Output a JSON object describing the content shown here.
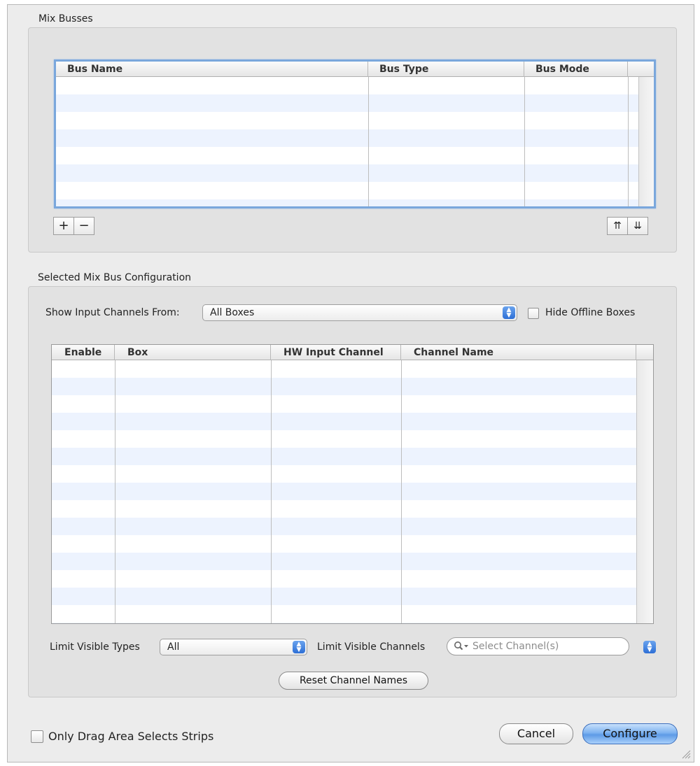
{
  "mix_busses": {
    "title": "Mix Busses",
    "columns": [
      "Bus Name",
      "Bus Type",
      "Bus Mode"
    ],
    "add_label": "+",
    "remove_label": "−",
    "move_up_label": "⇈",
    "move_down_label": "⇊"
  },
  "config": {
    "title": "Selected Mix Bus Configuration",
    "show_from_label": "Show Input Channels From:",
    "show_from_value": "All Boxes",
    "hide_offline_label": "Hide Offline Boxes",
    "hide_offline_checked": false,
    "columns": [
      "Enable",
      "Box",
      "HW Input Channel",
      "Channel Name"
    ],
    "limit_types_label": "Limit Visible Types",
    "limit_types_value": "All",
    "limit_channels_label": "Limit Visible Channels",
    "limit_channels_placeholder": "Select Channel(s)",
    "reset_label": "Reset Channel Names"
  },
  "footer": {
    "drag_label": "Only Drag Area Selects Strips",
    "drag_checked": false,
    "cancel_label": "Cancel",
    "configure_label": "Configure"
  },
  "colors": {
    "focus_ring": "#7aa7dc",
    "default_button": "#5e9ae6",
    "row_stripe": "#edf3fe"
  }
}
